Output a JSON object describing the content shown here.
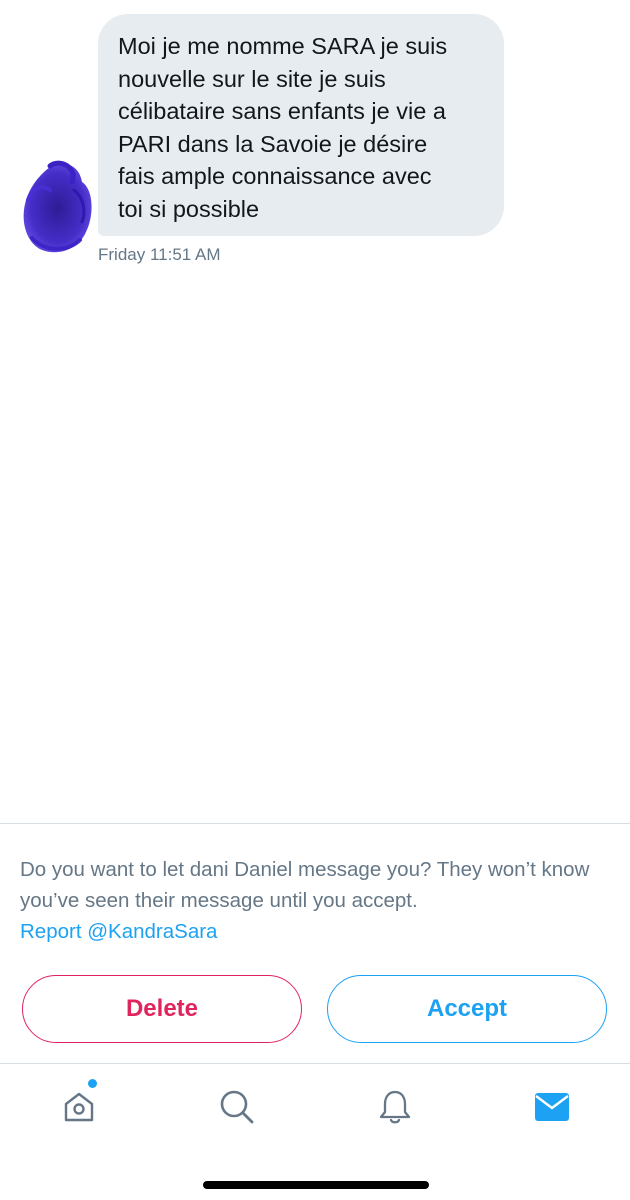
{
  "conversation": {
    "message": {
      "text": "Moi je me nomme SARA je suis\nnouvelle sur le site  je suis\ncélibataire sans enfants je vie a\nPARI dans la Savoie je désire\nfais ample connaissance avec\ntoi si possible",
      "timestamp": "Friday 11:51 AM"
    },
    "avatar": {
      "icon": "scribbled-avatar",
      "color": "#2a14b4"
    }
  },
  "request": {
    "prompt": "Do you want to let dani Daniel message you? They won’t know you’ve seen their message until you accept.",
    "report_link": "Report @KandraSara",
    "delete_label": "Delete",
    "accept_label": "Accept",
    "colors": {
      "delete": "#e0245e",
      "accept": "#1da1f2",
      "muted_text": "#657786"
    }
  },
  "tab_bar": {
    "items": [
      {
        "icon": "home-icon",
        "has_notification_dot": true,
        "active": false
      },
      {
        "icon": "search-icon",
        "active": false
      },
      {
        "icon": "bell-icon",
        "active": false
      },
      {
        "icon": "envelope-icon",
        "active": true
      }
    ],
    "active_color": "#1da1f2",
    "inactive_color": "#657786"
  }
}
